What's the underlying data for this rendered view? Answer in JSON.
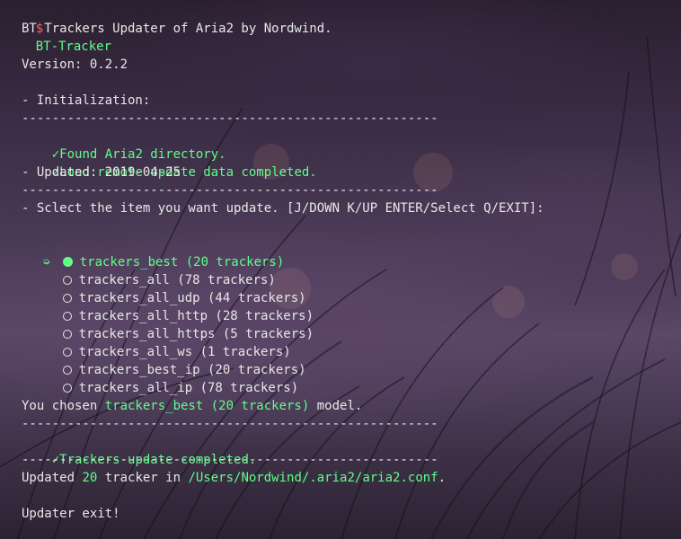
{
  "prompt_symbol": "$",
  "command": "BT-Tracker",
  "subtitle": "BT Trackers Updater of Aria2 by Nordwind.",
  "version_text": "Version: 0.2.2",
  "init_heading": "- Initialization:",
  "divider": "-------------------------------------------------------",
  "found_dir": "Found Aria2 directory.",
  "load_remote": "Load remote update data completed.",
  "updated_date": "- Updated: 2019-04-25",
  "select_prompt": "- Sclect the item you want update. [J/DOWN K/UP ENTER/Select Q/EXIT]:",
  "items": [
    {
      "label": "trackers_best (20 trackers)",
      "selected": true
    },
    {
      "label": "trackers_all (78 trackers)",
      "selected": false
    },
    {
      "label": "trackers_all_udp (44 trackers)",
      "selected": false
    },
    {
      "label": "trackers_all_http (28 trackers)",
      "selected": false
    },
    {
      "label": "trackers_all_https (5 trackers)",
      "selected": false
    },
    {
      "label": "trackers_all_ws (1 trackers)",
      "selected": false
    },
    {
      "label": "trackers_best_ip (20 trackers)",
      "selected": false
    },
    {
      "label": "trackers_all_ip (78 trackers)",
      "selected": false
    }
  ],
  "chosen_prefix": "You chosen ",
  "chosen_value": "trackers_best (20 trackers)",
  "chosen_suffix": " model.",
  "update_completed": "Trackers update completed.",
  "updated_prefix": "Updated ",
  "updated_count": "20",
  "updated_middle": " tracker in ",
  "updated_path": "/Users/Nordwind/.aria2/aria2.conf",
  "updated_suffix": ".",
  "exit_text": "Updater exit!",
  "colors": {
    "accent": "#5fff87",
    "prompt": "#ff5f5f"
  }
}
